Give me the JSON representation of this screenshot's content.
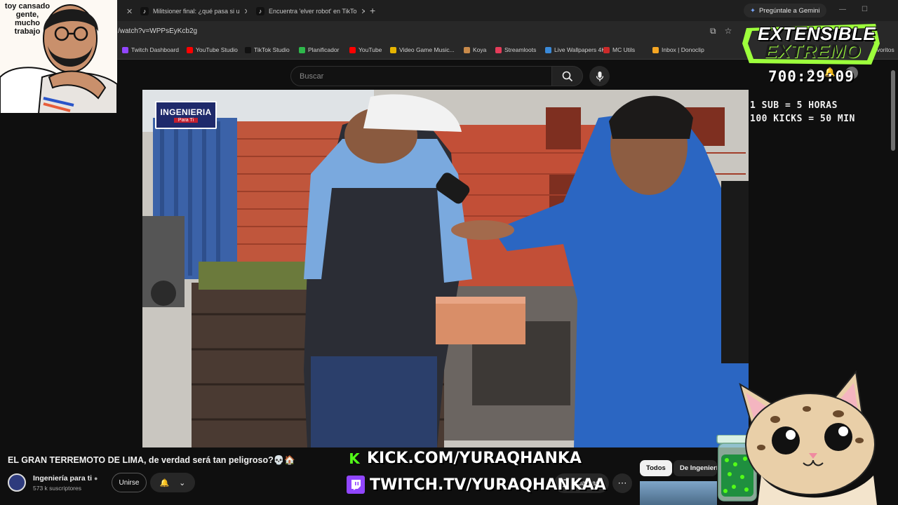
{
  "browser": {
    "tabs": [
      {
        "title": "Militsioner final: ¿qué pasa si u"
      },
      {
        "title": "Encuentra 'elver robot' en TikTo"
      }
    ],
    "new_tab": "+",
    "gemini_label": "Pregúntale a Gemini",
    "url": "/watch?v=WPPsEyKcb2g",
    "bookmarks": [
      {
        "label": "Twitch Dashboard",
        "color": "#9146ff"
      },
      {
        "label": "YouTube Studio",
        "color": "#ff0000"
      },
      {
        "label": "TikTok Studio",
        "color": "#111111"
      },
      {
        "label": "Planificador",
        "color": "#2eb84b"
      },
      {
        "label": "YouTube",
        "color": "#ff0000"
      },
      {
        "label": "Video Game Music...",
        "color": "#e6b400"
      },
      {
        "label": "Koya",
        "color": "#c88a4a"
      },
      {
        "label": "Streamloots",
        "color": "#e53c5a"
      },
      {
        "label": "Live Wallpapers 4K",
        "color": "#3a8ad9"
      },
      {
        "label": "MC Utils",
        "color": "#cc2a2a"
      },
      {
        "label": "Inbox | Donoclip",
        "color": "#f5a623"
      },
      {
        "label": "avoritos",
        "color": "#00000000"
      }
    ]
  },
  "youtube": {
    "search_placeholder": "Buscar",
    "video_title": "EL GRAN TERREMOTO DE LIMA, de verdad será tan peligroso?💀🏠",
    "channel_name": "Ingeniería para ti",
    "subscribers": "573 k suscriptores",
    "join_label": "Unirse",
    "save_label": "Guardar",
    "chips": [
      "Todos",
      "De Ingeniería"
    ],
    "video_logo": {
      "line1": "INGENIERIA",
      "line2": "Para Ti"
    }
  },
  "overlay": {
    "webcam_caption": "toy cansado gente, mucho trabajo",
    "logo_line1": "EXTENSIBLE",
    "logo_line2": "EXTREMO",
    "timer": "700:29:09",
    "rule1": "1 SUB = 5 HORAS",
    "rule2": "100 KICKS = 50 MIN",
    "kick_url": "KICK.COM/YURAQHANKA",
    "twitch_url": "TWITCH.TV/YURAQHANKAA",
    "accent_kick": "#53fc18",
    "accent_twitch": "#9146ff"
  }
}
